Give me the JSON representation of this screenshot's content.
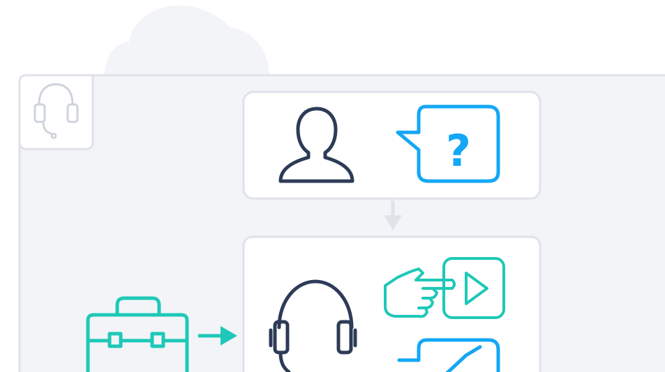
{
  "diagram": {
    "question_mark": "?"
  },
  "colors": {
    "page_background": "#ffffff",
    "panel_background": "#f3f4f8",
    "outline_gray": "#dfe2e9",
    "card_border": "#dfe2e9",
    "navy": "#2d3b57",
    "blue": "#13a7f5",
    "teal": "#1ec8b8",
    "muted_icon": "#cfd3dc"
  },
  "icons": {
    "cloud": "cloud-icon",
    "corner_badge": "headset-icon",
    "user": "user-icon",
    "question_bubble": "question-bubble-icon",
    "arrow_down": "arrow-down-icon",
    "toolbox": "toolbox-icon",
    "arrow_right": "arrow-right-icon",
    "agent_headset": "headset-icon",
    "pointing_hand": "pointing-hand-icon",
    "play_button": "play-button-icon",
    "check_bubble": "check-bubble-icon"
  }
}
